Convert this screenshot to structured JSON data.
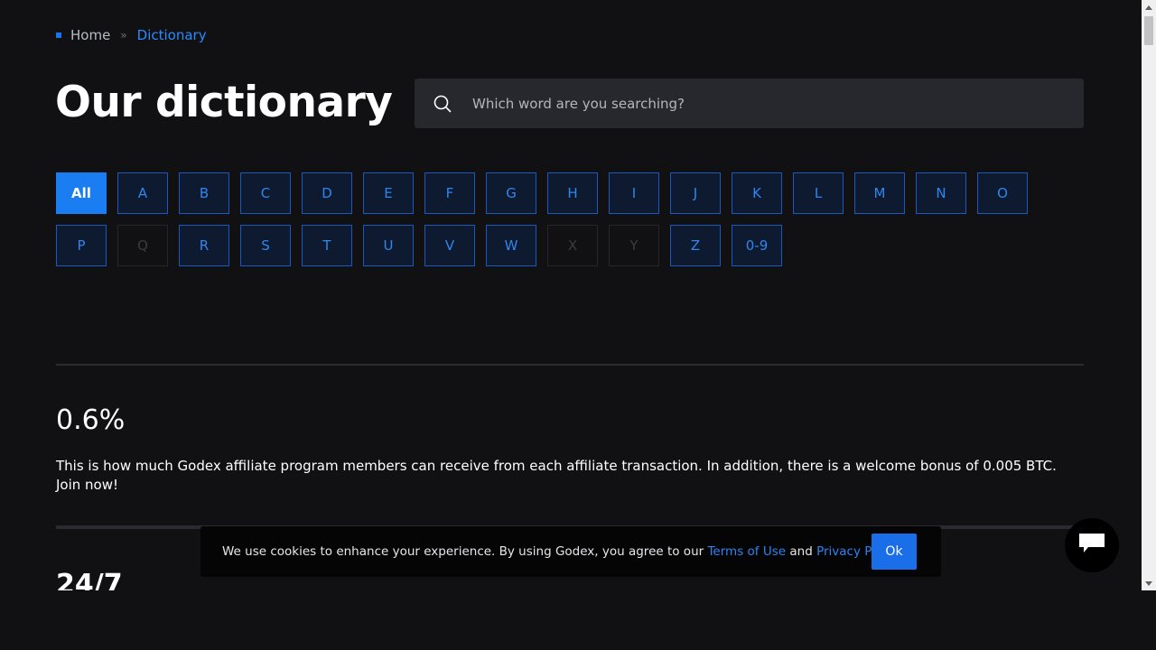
{
  "breadcrumb": {
    "home": "Home",
    "separator": "»",
    "current": "Dictionary"
  },
  "page": {
    "title": "Our dictionary"
  },
  "search": {
    "placeholder": "Which word are you searching?",
    "icon": "search-icon"
  },
  "letters": {
    "active": "All",
    "rows": [
      [
        "All",
        "A",
        "B",
        "C",
        "D",
        "E",
        "F",
        "G",
        "H",
        "I",
        "J",
        "K",
        "L",
        "M",
        "N",
        "O"
      ],
      [
        "P",
        "Q",
        "R",
        "S",
        "T",
        "U",
        "V",
        "W",
        "X",
        "Y",
        "Z",
        "0-9"
      ]
    ],
    "disabled": [
      "Q",
      "X",
      "Y"
    ]
  },
  "facts": [
    {
      "value": "0.6%",
      "text": "This is how much Godex affiliate program members can receive from each affiliate transaction. In addition, there is a welcome bonus of 0.005 BTC. Join now!"
    },
    {
      "value": "24/7"
    }
  ],
  "cookie": {
    "text_before": "We use cookies to enhance your experience. By using Godex, you agree to our",
    "terms": "Terms of Use",
    "and": "and",
    "privacy": "Privacy Policy",
    "ok": "Ok"
  },
  "chat": {
    "icon": "chat-icon"
  },
  "colors": {
    "background": "#111114",
    "accent": "#1a7df1",
    "letter_border": "#1a5ac0"
  }
}
